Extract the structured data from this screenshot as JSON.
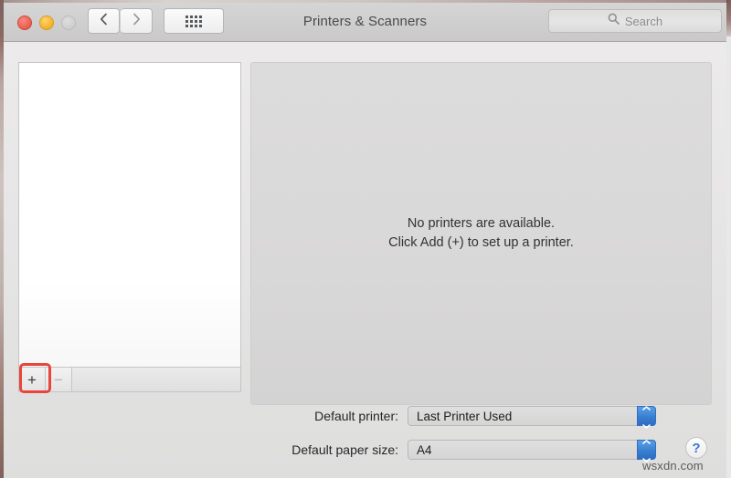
{
  "window": {
    "title": "Printers & Scanners",
    "traffic_lights": [
      {
        "name": "close",
        "color": "#ea5c4f"
      },
      {
        "name": "minimize",
        "color": "#f2b02a"
      },
      {
        "name": "zoom",
        "color": "#cfcece"
      }
    ]
  },
  "toolbar": {
    "back_icon": "chevron-left-icon",
    "forward_icon": "chevron-right-icon",
    "show_all_icon": "grid-dots-icon",
    "search": {
      "placeholder": "Search",
      "icon": "search-icon"
    }
  },
  "printer_list": {
    "items": [],
    "add_label": "+",
    "remove_label": "−",
    "add_highlight_color": "#e8453c"
  },
  "detail": {
    "empty_line1": "No printers are available.",
    "empty_line2": "Click Add (+) to set up a printer."
  },
  "settings": {
    "default_printer": {
      "label": "Default printer:",
      "value": "Last Printer Used"
    },
    "default_paper_size": {
      "label": "Default paper size:",
      "value": "A4"
    },
    "stepper_color": "#3a80d2"
  },
  "help": {
    "label": "?",
    "color": "#3a77d4"
  },
  "watermark": {
    "text": "wsxdn.com"
  }
}
